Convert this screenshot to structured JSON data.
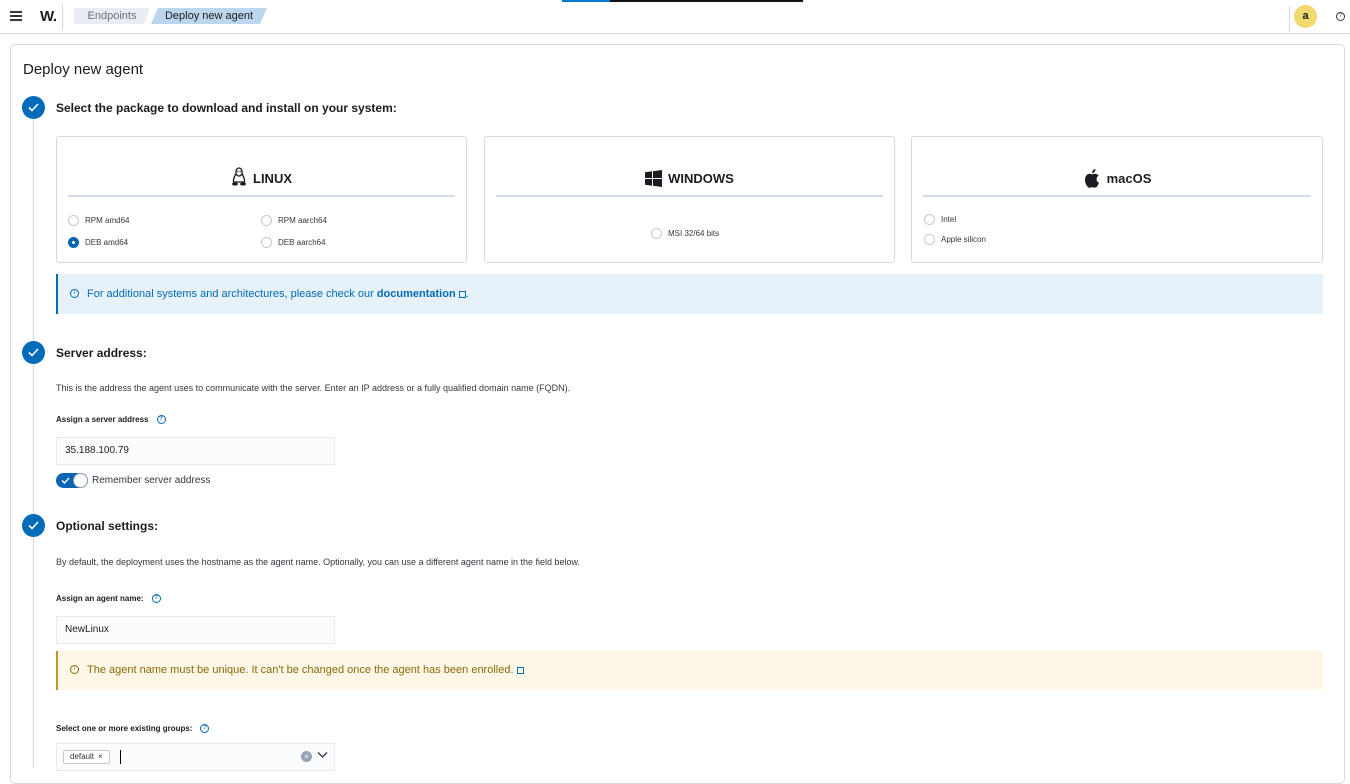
{
  "header": {
    "logo": "W.",
    "breadcrumbs": [
      "Endpoints",
      "Deploy new agent"
    ],
    "avatar_initial": "a",
    "help_icon": "help-icon"
  },
  "page": {
    "title": "Deploy new agent"
  },
  "steps": {
    "package": {
      "title": "Select the package to download and install on your system:",
      "linux": {
        "name": "LINUX",
        "options": [
          "RPM amd64",
          "RPM aarch64",
          "DEB amd64",
          "DEB aarch64"
        ],
        "selected": "DEB amd64"
      },
      "windows": {
        "name": "WINDOWS",
        "options": [
          "MSI 32/64 bits"
        ]
      },
      "macos": {
        "name": "macOS",
        "options": [
          "Intel",
          "Apple silicon"
        ]
      },
      "callout": {
        "text": "For additional systems and architectures, please check our",
        "link": "documentation",
        "suffix": "."
      }
    },
    "server": {
      "title": "Server address:",
      "description": "This is the address the agent uses to communicate with the server. Enter an IP address or a fully qualified domain name (FQDN).",
      "field_label": "Assign a server address",
      "value": "35.188.100.79",
      "remember_label": "Remember server address",
      "remember_on": true
    },
    "optional": {
      "title": "Optional settings:",
      "description": "By default, the deployment uses the hostname as the agent name. Optionally, you can use a different agent name in the field below.",
      "name_label": "Assign an agent name:",
      "name_value": "NewLinux",
      "warning": "The agent name must be unique. It can't be changed once the agent has been enrolled.",
      "groups_label": "Select one or more existing groups:",
      "groups_selected": [
        "default"
      ]
    }
  },
  "colors": {
    "primary": "#006bb8",
    "info_bg": "#e6f1fa",
    "warning_bg": "#fef6e6",
    "avatar": "#f1d86f"
  }
}
